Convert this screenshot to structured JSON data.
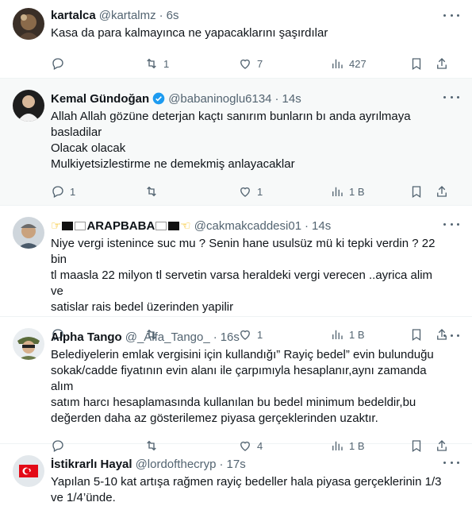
{
  "tweets": [
    {
      "name": "kartalca",
      "handle": "@kartalmz",
      "time": "6s",
      "text": "Kasa da para kalmayınca ne yapacaklarını şaşırdılar",
      "replies": "",
      "retweets": "1",
      "likes": "7",
      "views": "427",
      "highlight": false
    },
    {
      "name": "Kemal Gündoğan",
      "handle": "@babaninoglu6134",
      "time": "14s",
      "text": "Allah Allah gözüne deterjan kaçtı sanırım bunların bı anda ayrılmaya\nbasladilar\nOlacak olacak\nMulkiyetsizlestirme ne demekmiş anlayacaklar",
      "replies": "1",
      "retweets": "",
      "likes": "1",
      "views": "1 B",
      "highlight": true,
      "verified": true
    },
    {
      "name": "ARAPBABA",
      "handle": "@cakmakcaddesi01",
      "time": "14s",
      "text": "Niye vergi istenince suc mu ? Senin hane usulsüz mü ki tepki verdin ? 22 bin\ntl maasla 22 milyon tl servetin varsa heraldeki vergi verecen ..ayrica alim ve\nsatislar rais bedel üzerinden yapilir",
      "replies": "",
      "retweets": "",
      "likes": "1",
      "views": "1 B",
      "highlight": false
    },
    {
      "name": "Alpha Tango",
      "handle": "@_Alfa_Tango_",
      "time": "16s",
      "text": "Belediyelerin emlak vergisini için kullandığı” Rayiç bedel” evin bulunduğu\nsokak/cadde fiyatının evin alanı ile çarpımıyla hesaplanır,aynı zamanda alım\nsatım harcı hesaplamasında kullanılan bu bedel minimum bedeldir,bu\ndeğerden daha az gösterilemez piyasa gerçeklerinden uzaktır.",
      "replies": "",
      "retweets": "",
      "likes": "4",
      "views": "1 B",
      "highlight": false
    },
    {
      "name": "İstikrarlı Hayal",
      "handle": "@lordofthecryp",
      "time": "17s",
      "text": "Yapılan 5-10 kat artışa rağmen rayiç bedeller hala piyasa gerçeklerinin 1/3\nve 1/4’ünde.",
      "replies": "",
      "retweets": "",
      "likes": "",
      "views": "",
      "highlight": false
    }
  ],
  "separator": "·",
  "colors": {
    "text": "#0f1419",
    "secondary": "#536471",
    "verified": "#1d9bf0",
    "highlight_bg": "#f7f9f9"
  }
}
